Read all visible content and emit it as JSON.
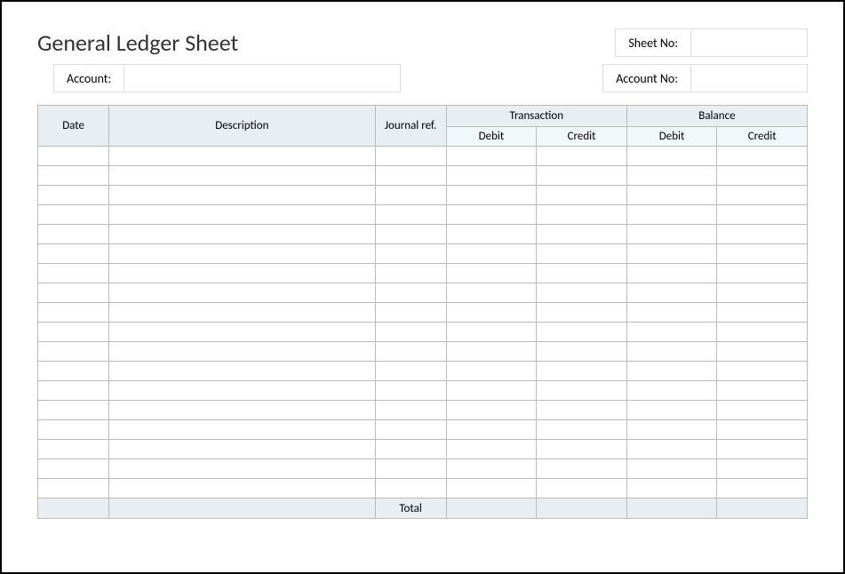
{
  "title": "General Ledger Sheet",
  "sheetNo": {
    "label": "Sheet No:",
    "value": ""
  },
  "account": {
    "label": "Account:",
    "value": ""
  },
  "accountNo": {
    "label": "Account No:",
    "value": ""
  },
  "columns": {
    "date": "Date",
    "description": "Description",
    "journalRef": "Journal ref.",
    "transaction": "Transaction",
    "balance": "Balance",
    "debit": "Debit",
    "credit": "Credit"
  },
  "rows": [
    {
      "date": "",
      "description": "",
      "journalRef": "",
      "tDebit": "",
      "tCredit": "",
      "bDebit": "",
      "bCredit": ""
    },
    {
      "date": "",
      "description": "",
      "journalRef": "",
      "tDebit": "",
      "tCredit": "",
      "bDebit": "",
      "bCredit": ""
    },
    {
      "date": "",
      "description": "",
      "journalRef": "",
      "tDebit": "",
      "tCredit": "",
      "bDebit": "",
      "bCredit": ""
    },
    {
      "date": "",
      "description": "",
      "journalRef": "",
      "tDebit": "",
      "tCredit": "",
      "bDebit": "",
      "bCredit": ""
    },
    {
      "date": "",
      "description": "",
      "journalRef": "",
      "tDebit": "",
      "tCredit": "",
      "bDebit": "",
      "bCredit": ""
    },
    {
      "date": "",
      "description": "",
      "journalRef": "",
      "tDebit": "",
      "tCredit": "",
      "bDebit": "",
      "bCredit": ""
    },
    {
      "date": "",
      "description": "",
      "journalRef": "",
      "tDebit": "",
      "tCredit": "",
      "bDebit": "",
      "bCredit": ""
    },
    {
      "date": "",
      "description": "",
      "journalRef": "",
      "tDebit": "",
      "tCredit": "",
      "bDebit": "",
      "bCredit": ""
    },
    {
      "date": "",
      "description": "",
      "journalRef": "",
      "tDebit": "",
      "tCredit": "",
      "bDebit": "",
      "bCredit": ""
    },
    {
      "date": "",
      "description": "",
      "journalRef": "",
      "tDebit": "",
      "tCredit": "",
      "bDebit": "",
      "bCredit": ""
    },
    {
      "date": "",
      "description": "",
      "journalRef": "",
      "tDebit": "",
      "tCredit": "",
      "bDebit": "",
      "bCredit": ""
    },
    {
      "date": "",
      "description": "",
      "journalRef": "",
      "tDebit": "",
      "tCredit": "",
      "bDebit": "",
      "bCredit": ""
    },
    {
      "date": "",
      "description": "",
      "journalRef": "",
      "tDebit": "",
      "tCredit": "",
      "bDebit": "",
      "bCredit": ""
    },
    {
      "date": "",
      "description": "",
      "journalRef": "",
      "tDebit": "",
      "tCredit": "",
      "bDebit": "",
      "bCredit": ""
    },
    {
      "date": "",
      "description": "",
      "journalRef": "",
      "tDebit": "",
      "tCredit": "",
      "bDebit": "",
      "bCredit": ""
    },
    {
      "date": "",
      "description": "",
      "journalRef": "",
      "tDebit": "",
      "tCredit": "",
      "bDebit": "",
      "bCredit": ""
    },
    {
      "date": "",
      "description": "",
      "journalRef": "",
      "tDebit": "",
      "tCredit": "",
      "bDebit": "",
      "bCredit": ""
    },
    {
      "date": "",
      "description": "",
      "journalRef": "",
      "tDebit": "",
      "tCredit": "",
      "bDebit": "",
      "bCredit": ""
    }
  ],
  "footer": {
    "totalLabel": "Total",
    "tDebit": "",
    "tCredit": "",
    "bDebit": "",
    "bCredit": ""
  }
}
